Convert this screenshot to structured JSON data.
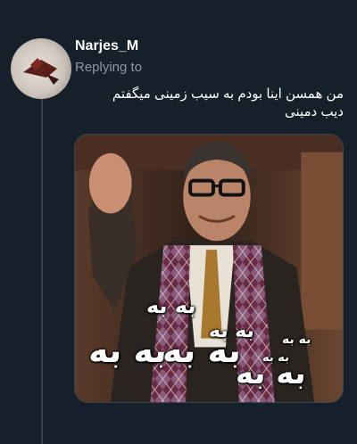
{
  "tweet": {
    "username": "Narjes_M",
    "replying_label": "Replying to",
    "text_line1": "من همسن اینا بودم به سیب زمینی میگفتم",
    "text_line2": "دیب دمینی"
  },
  "media": {
    "overlay_texts": [
      "به به",
      "به به",
      "به به",
      "به به",
      "به به",
      "به به",
      "به به"
    ]
  },
  "colors": {
    "background": "#15202b",
    "secondary_text": "#8899a6",
    "thread_line": "#38444d"
  }
}
